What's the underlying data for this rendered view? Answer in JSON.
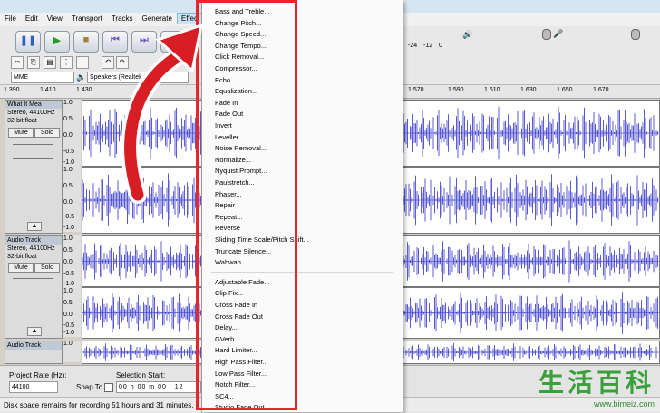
{
  "menubar": [
    "File",
    "Edit",
    "View",
    "Transport",
    "Tracks",
    "Generate",
    "Effect"
  ],
  "device": {
    "host": "MME",
    "output": "Speakers (Realtek Hi...",
    "meter_labels": [
      "-24",
      "-12",
      "0"
    ]
  },
  "ruler_ticks": [
    "1.390",
    "1.410",
    "1.430",
    "1.570",
    "1.590",
    "1.610",
    "1.630",
    "1.650",
    "1.670"
  ],
  "tracks": [
    {
      "name": "What It Mea",
      "info1": "Stereo, 44100Hz",
      "info2": "32-bit float",
      "mute": "Mute",
      "solo": "Solo",
      "scale": [
        "1.0",
        "0.5",
        "0.0",
        "-0.5",
        "-1.0",
        "1.0",
        "0.5",
        "0.0",
        "-0.5",
        "-1.0"
      ]
    },
    {
      "name": "Audio Track",
      "info1": "Stereo, 44100Hz",
      "info2": "32-bit float",
      "mute": "Mute",
      "solo": "Solo",
      "scale": [
        "1.0",
        "0.5",
        "0.0",
        "-0.5",
        "-1.0",
        "1.0",
        "0.5",
        "0.0",
        "-0.5",
        "-1.0"
      ]
    },
    {
      "name": "Audio Track",
      "scale": [
        "1.0"
      ]
    }
  ],
  "bottom": {
    "project_rate_label": "Project Rate (Hz):",
    "project_rate_value": "44100",
    "snap_label": "Snap To",
    "selection_label": "Selection Start:",
    "selection_value": "00 h 00 m 00 . 12"
  },
  "status": "Disk space remains for recording 51 hours and 31 minutes.",
  "effect_menu": {
    "group1": [
      "Bass and Treble...",
      "Change Pitch...",
      "Change Speed...",
      "Change Tempo...",
      "Click Removal...",
      "Compressor...",
      "Echo...",
      "Equalization...",
      "Fade In",
      "Fade Out",
      "Invert",
      "Leveller...",
      "Noise Removal...",
      "Normalize...",
      "Nyquist Prompt...",
      "Paulstretch...",
      "Phaser...",
      "Repair",
      "Repeat...",
      "Reverse",
      "Sliding Time Scale/Pitch Shift...",
      "Truncate Silence...",
      "Wahwah..."
    ],
    "group2": [
      "Adjustable Fade...",
      "Clip Fix...",
      "Cross Fade In",
      "Cross Fade Out",
      "Delay...",
      "GVerb...",
      "Hard Limiter...",
      "High Pass Filter...",
      "Low Pass Filter...",
      "Notch Filter...",
      "SC4...",
      "Studio Fade Out"
    ]
  },
  "watermark": {
    "cn": "生活百科",
    "url": "www.bimeiz.com"
  },
  "colors": {
    "highlight": "#e8242c",
    "waveform": "#3333cc",
    "arrow": "#d81e25",
    "watermark": "#2e8b2e"
  }
}
